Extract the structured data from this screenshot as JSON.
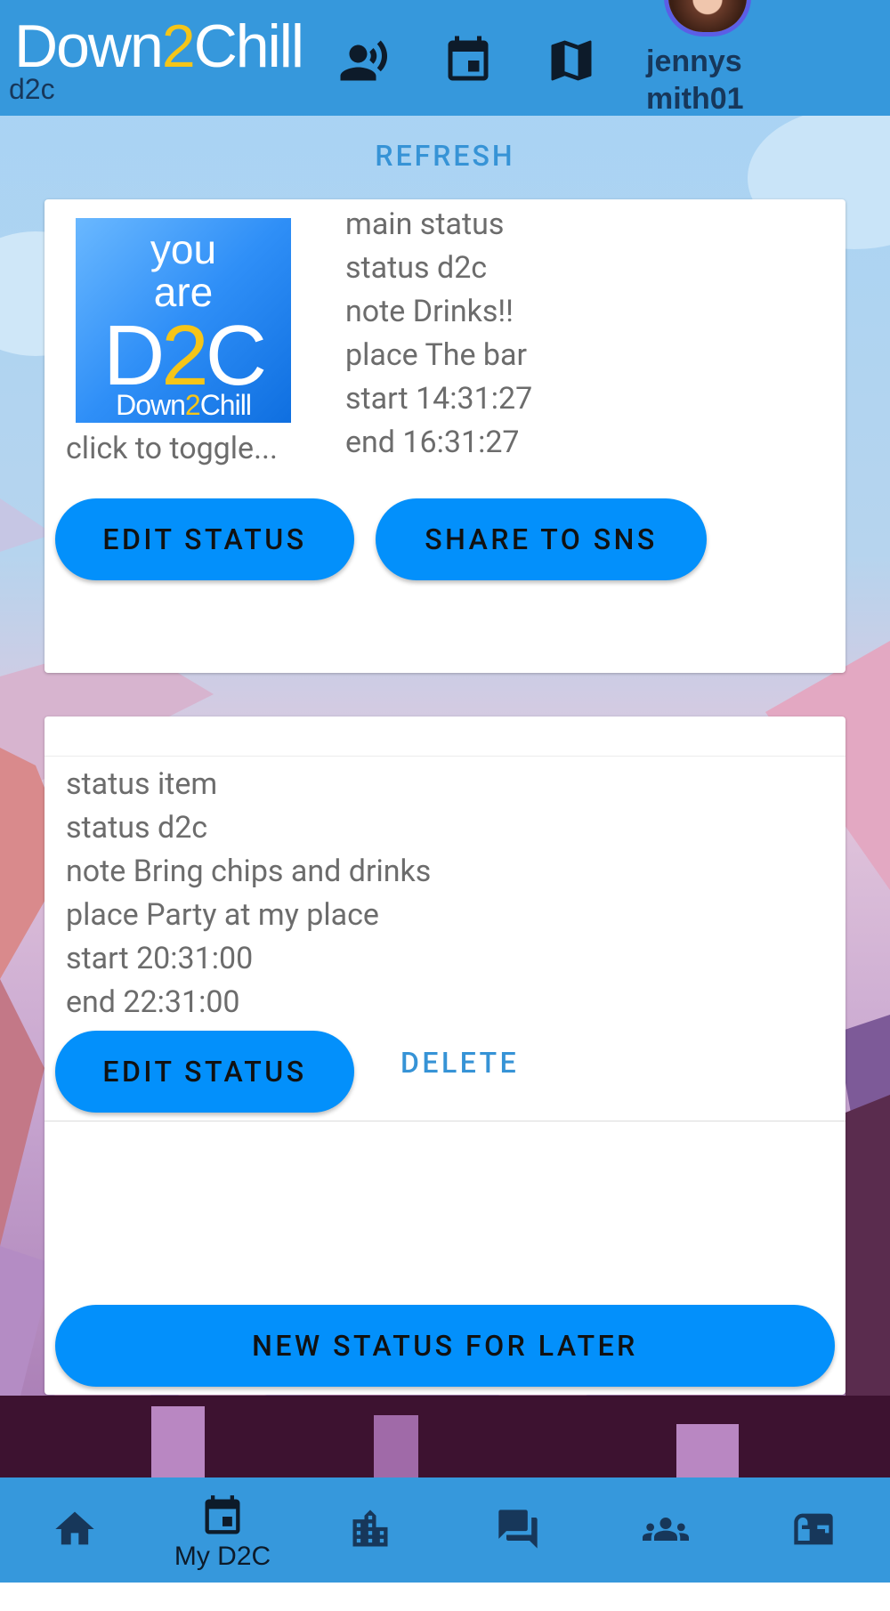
{
  "header": {
    "logo_prefix": "Down",
    "logo_two": "2",
    "logo_suffix": "Chill",
    "logo_sub": "d2c",
    "username": "jennysmith01",
    "icons": [
      "broadcast-person-icon",
      "calendar-icon",
      "map-icon"
    ]
  },
  "refresh_label": "REFRESH",
  "main_card": {
    "image": {
      "line1": "you",
      "line2": "are",
      "line3_a": "D",
      "line3_b": "2",
      "line3_c": "C",
      "line4_a": "Down",
      "line4_b": "2",
      "line4_c": "Chill"
    },
    "toggle_caption": "click to toggle...",
    "lines": [
      "main status",
      "status d2c",
      "note Drinks!!",
      "place The bar",
      "start 14:31:27",
      "end 16:31:27"
    ],
    "edit_label": "EDIT STATUS",
    "share_label": "SHARE TO SNS"
  },
  "later_card": {
    "lines": [
      "status item",
      "status d2c",
      "note Bring chips and drinks",
      "place Party at my place",
      "start 20:31:00",
      "end 22:31:00"
    ],
    "edit_label": "EDIT STATUS",
    "delete_label": "DELETE",
    "new_label": "NEW STATUS FOR LATER"
  },
  "bottom_nav": {
    "items": [
      {
        "icon": "home-icon",
        "label": ""
      },
      {
        "icon": "calendar-icon",
        "label": "My D2C"
      },
      {
        "icon": "city-icon",
        "label": ""
      },
      {
        "icon": "forum-icon",
        "label": ""
      },
      {
        "icon": "group-icon",
        "label": ""
      },
      {
        "icon": "mailbox-icon",
        "label": ""
      }
    ],
    "active_index": 1
  },
  "colors": {
    "header_bg": "#3698dc",
    "button_bg": "#0390fb",
    "accent_text": "#3693d6",
    "logo_yellow": "#f5c518"
  }
}
